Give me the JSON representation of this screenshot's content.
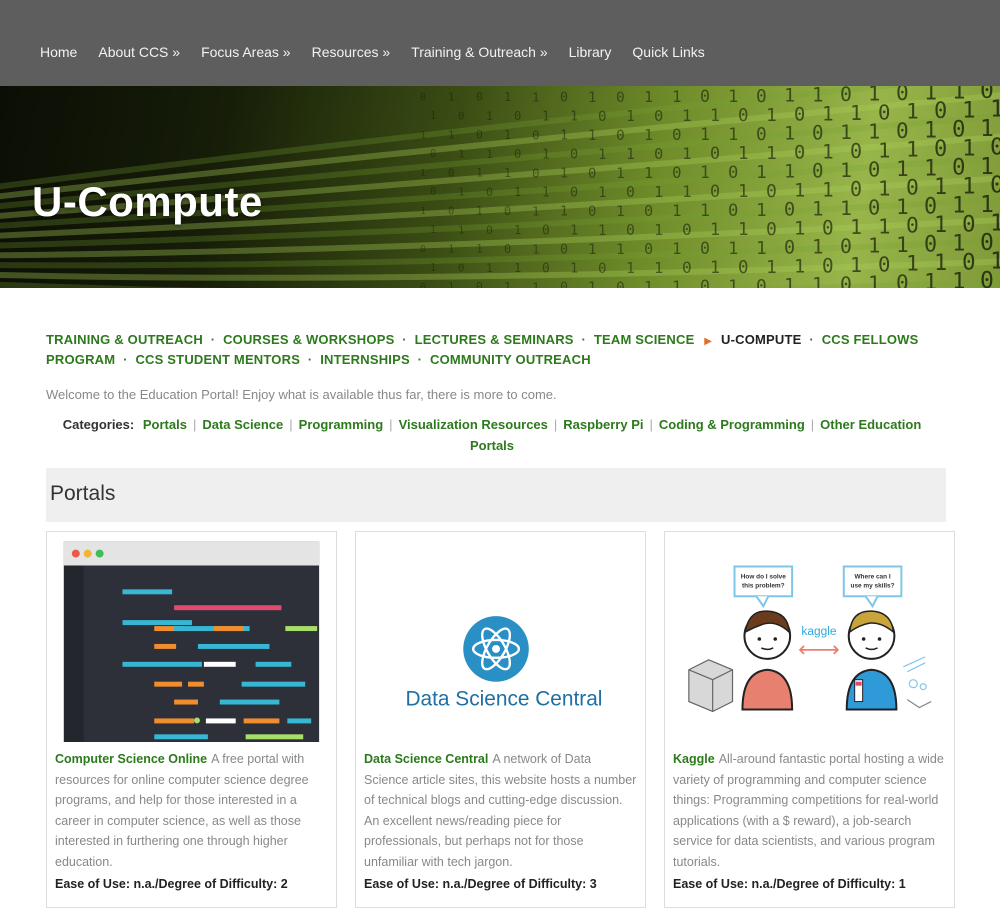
{
  "nav": {
    "items": [
      "Home",
      "About CCS »",
      "Focus Areas »",
      "Resources »",
      "Training & Outreach »",
      "Library",
      "Quick Links"
    ]
  },
  "hero": {
    "title": "U-Compute"
  },
  "breadcrumb": {
    "items": [
      {
        "label": "TRAINING & OUTREACH"
      },
      {
        "label": "COURSES & WORKSHOPS"
      },
      {
        "label": "LECTURES & SEMINARS"
      },
      {
        "label": "TEAM SCIENCE"
      },
      {
        "label": "U-COMPUTE",
        "current": true
      },
      {
        "label": "CCS FELLOWS PROGRAM"
      },
      {
        "label": "CCS STUDENT MENTORS"
      },
      {
        "label": "INTERNSHIPS"
      },
      {
        "label": "COMMUNITY OUTREACH"
      }
    ]
  },
  "welcome": "Welcome to the Education Portal! Enjoy what is available thus far, there is more to come.",
  "categories": {
    "label": "Categories:",
    "items": [
      "Portals",
      "Data Science",
      "Programming",
      "Visualization Resources",
      "Raspberry Pi",
      "Coding & Programming",
      "Other Education Portals"
    ]
  },
  "section": {
    "title": "Portals"
  },
  "cards": [
    {
      "title": "Computer Science Online",
      "description": "A free portal with resources for online computer science degree programs, and help for those interested in a career in computer science, as well as those interested in furthering one through higher education.",
      "ease": "Ease of Use: n.a./Degree of Difficulty: 2"
    },
    {
      "title": "Data Science Central",
      "description": "A network of Data Science article sites, this website hosts a number of technical blogs and cutting-edge discussion. An excellent news/reading piece for professionals, but perhaps not for those unfamiliar with tech jargon.",
      "ease": "Ease of Use: n.a./Degree of Difficulty: 3",
      "logo_text": "Data Science Central"
    },
    {
      "title": "Kaggle",
      "description": "All-around fantastic portal hosting a wide variety of programming and computer science things: Programming competitions for real-world applications (with a $ reward), a job-search service for data scientists, and various program tutorials.",
      "ease": "Ease of Use: n.a./Degree of Difficulty: 1",
      "bubble_left": [
        "How do I solve",
        "this problem?"
      ],
      "bubble_right": [
        "Where can I",
        "use my skills?"
      ],
      "logo_text": "kaggle"
    }
  ],
  "colors": {
    "nav_bg": "#5e5e5e",
    "link_green": "#2c7a1c",
    "breadcrumb_arrow": "#e0702a",
    "section_bg": "#efefef"
  }
}
